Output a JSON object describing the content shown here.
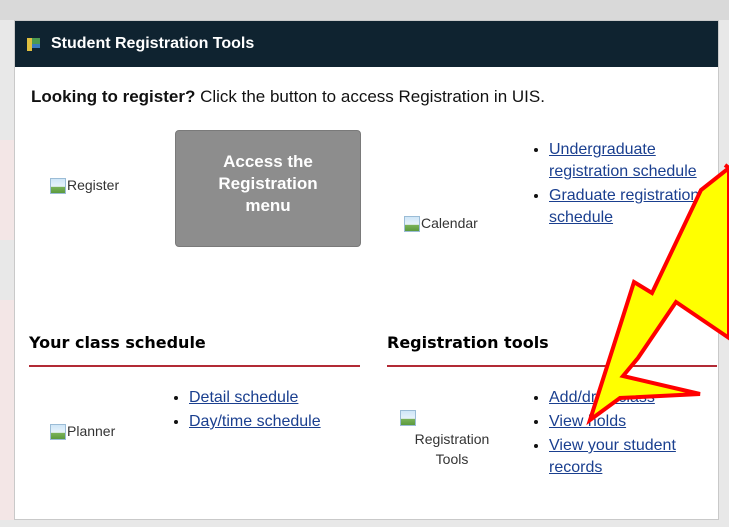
{
  "header": {
    "title": "Student Registration Tools"
  },
  "intro": {
    "bold": "Looking to register?",
    "rest": " Click the button to access Registration in UIS."
  },
  "register": {
    "image_alt": "Register",
    "button_lines": [
      "Access the",
      "Registration",
      "menu"
    ]
  },
  "calendar": {
    "image_alt": "Calendar",
    "links": [
      "Undergraduate registration schedule",
      "Graduate registration schedule"
    ]
  },
  "class_schedule": {
    "heading": "Your class schedule",
    "image_alt": "Planner",
    "links": [
      "Detail schedule",
      "Day/time schedule"
    ]
  },
  "registration_tools": {
    "heading": "Registration tools",
    "image_alt_line1": "Registration",
    "image_alt_line2": "Tools",
    "links": [
      "Add/drop class",
      "View holds",
      "View your student records"
    ]
  },
  "colors": {
    "header_bg": "#0f2330",
    "section_rule": "#b22a35",
    "button_bg": "#8d8d8d",
    "link": "#1a3f8f",
    "annotation_arrow_fill": "#ffff00",
    "annotation_arrow_stroke": "#ff0000"
  }
}
